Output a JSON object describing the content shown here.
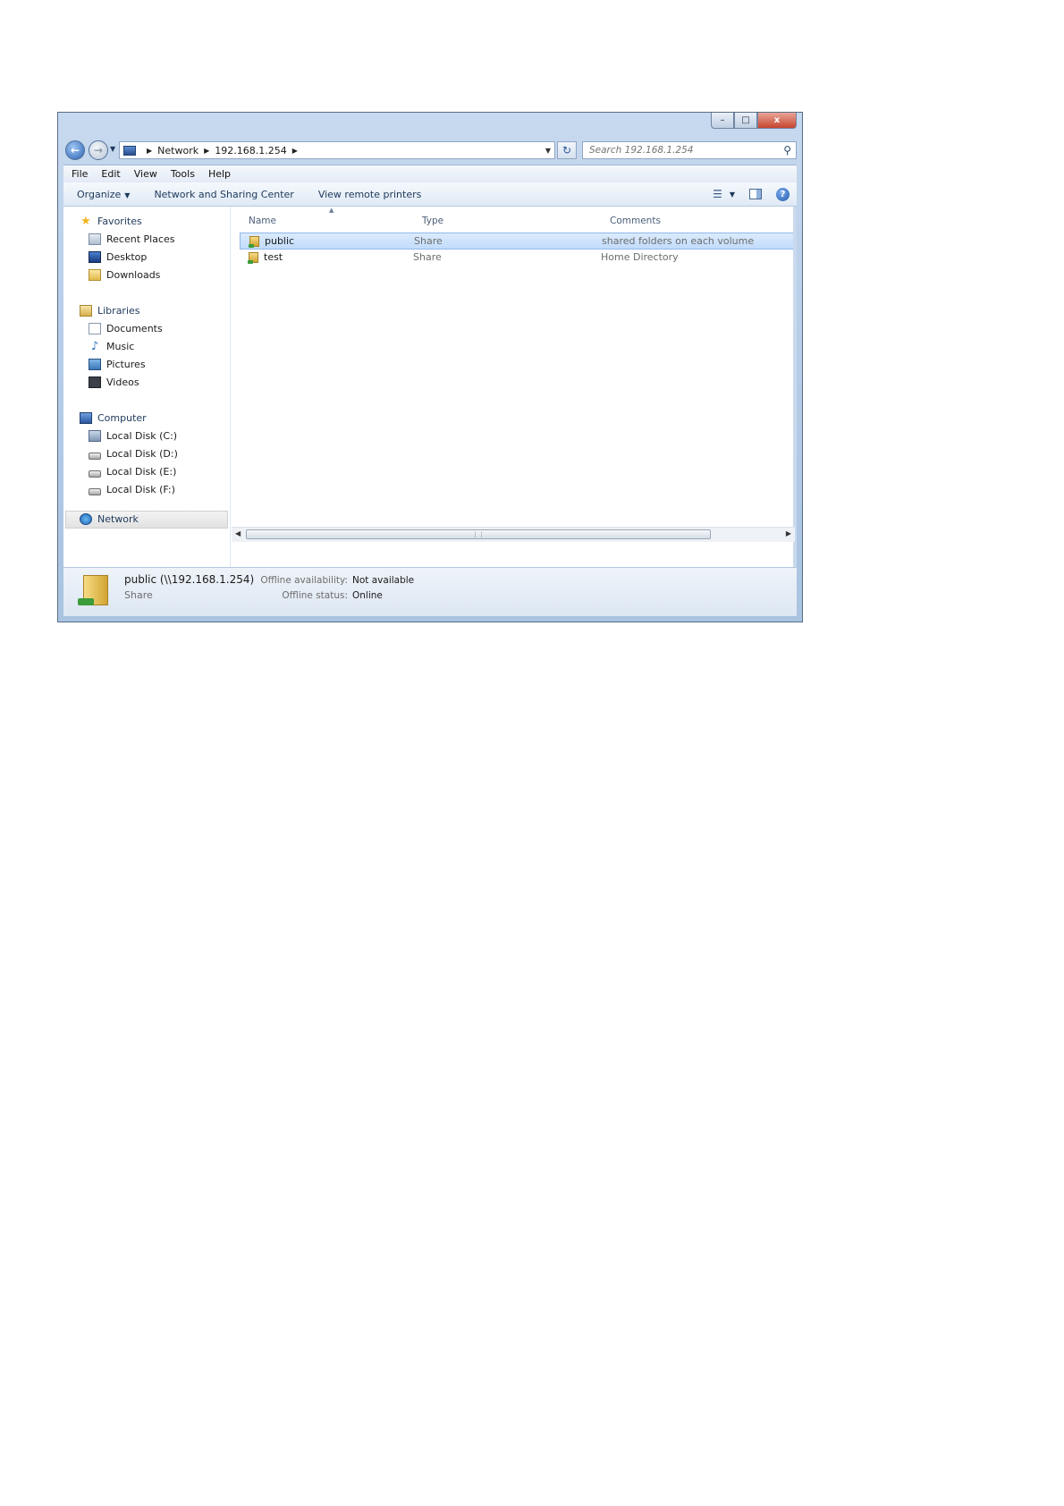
{
  "window": {
    "caption_minimize": "–",
    "caption_maximize": "□",
    "caption_close": "x"
  },
  "address": {
    "crumbs": [
      "Network",
      "192.168.1.254"
    ]
  },
  "search": {
    "placeholder": "Search 192.168.1.254"
  },
  "menu": [
    "File",
    "Edit",
    "View",
    "Tools",
    "Help"
  ],
  "toolbar": {
    "organize": "Organize",
    "network_center": "Network and Sharing Center",
    "remote_printers": "View remote printers"
  },
  "nav": {
    "favorites": "Favorites",
    "recent_places": "Recent Places",
    "desktop": "Desktop",
    "downloads": "Downloads",
    "libraries": "Libraries",
    "documents": "Documents",
    "music": "Music",
    "pictures": "Pictures",
    "videos": "Videos",
    "computer": "Computer",
    "disk_c": "Local Disk (C:)",
    "disk_d": "Local Disk (D:)",
    "disk_e": "Local Disk (E:)",
    "disk_f": "Local Disk (F:)",
    "network": "Network"
  },
  "columns": {
    "name": "Name",
    "type": "Type",
    "comments": "Comments"
  },
  "rows": [
    {
      "name": "public",
      "type": "Share",
      "comments": "shared folders on each volume"
    },
    {
      "name": "test",
      "type": "Share",
      "comments": "Home Directory"
    }
  ],
  "details": {
    "title": "public (\\\\192.168.1.254)",
    "subtitle": "Share",
    "offline_availability_label": "Offline availability:",
    "offline_availability_value": "Not available",
    "offline_status_label": "Offline status:",
    "offline_status_value": "Online"
  }
}
